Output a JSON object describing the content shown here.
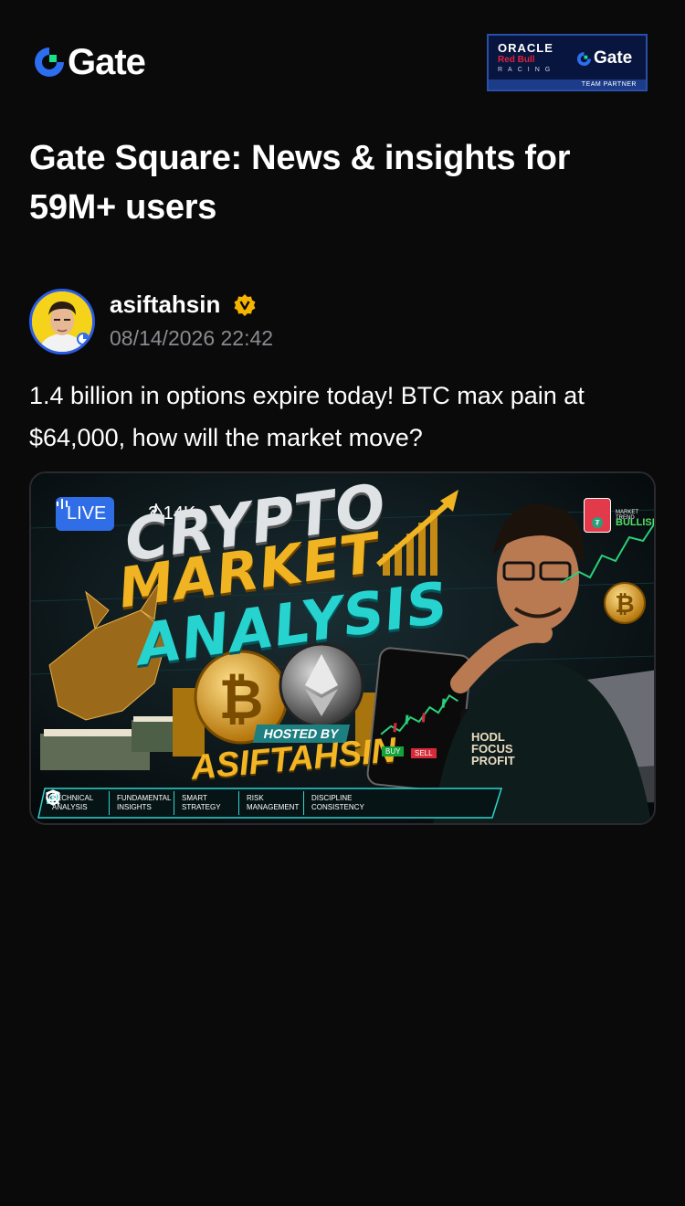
{
  "header": {
    "logo_text": "Gate",
    "partner_badge": {
      "line1": "ORACLE",
      "line2": "Red Bull",
      "line3": "RACING",
      "brand": "Gate",
      "caption": "TEAM PARTNER"
    }
  },
  "headline": "Gate Square: News & insights for 59M+ users",
  "post": {
    "author": "asiftahsin",
    "verified": true,
    "timestamp": "08/14/2026 22:42",
    "text": "1.4 billion in options expire today! BTC max pain at $64,000, how will the market move?",
    "media": {
      "live_label": "LIVE",
      "viewer_count": "2.14K",
      "title_line1": "CRYPTO",
      "title_line2": "MARKET",
      "title_line3": "ANALYSIS",
      "hosted_by": "HOSTED BY",
      "host_name": "ASIFTAHSIN",
      "mug_text": "HODL FOCUS PROFIT",
      "phone_buy": "BUY",
      "phone_sell": "SELL",
      "trend_label": "MARKET TREND",
      "bullish_label": "BULLISH",
      "features": [
        {
          "line1": "TECHNICAL",
          "line2": "ANALYSIS",
          "icon": "chart-icon"
        },
        {
          "line1": "FUNDAMENTAL",
          "line2": "INSIGHTS",
          "icon": "magnifier-icon"
        },
        {
          "line1": "SMART",
          "line2": "STRATEGY",
          "icon": "brain-icon"
        },
        {
          "line1": "RISK",
          "line2": "MANAGEMENT",
          "icon": "shield-icon"
        },
        {
          "line1": "DISCIPLINE",
          "line2": "CONSISTENCY",
          "icon": "target-icon"
        }
      ]
    }
  },
  "colors": {
    "background": "#0a0a0b",
    "accent_blue": "#2f6ee6",
    "gate_green": "#17e28b",
    "timestamp_gray": "#8a8a8f",
    "verified_gold": "#f5b400"
  }
}
